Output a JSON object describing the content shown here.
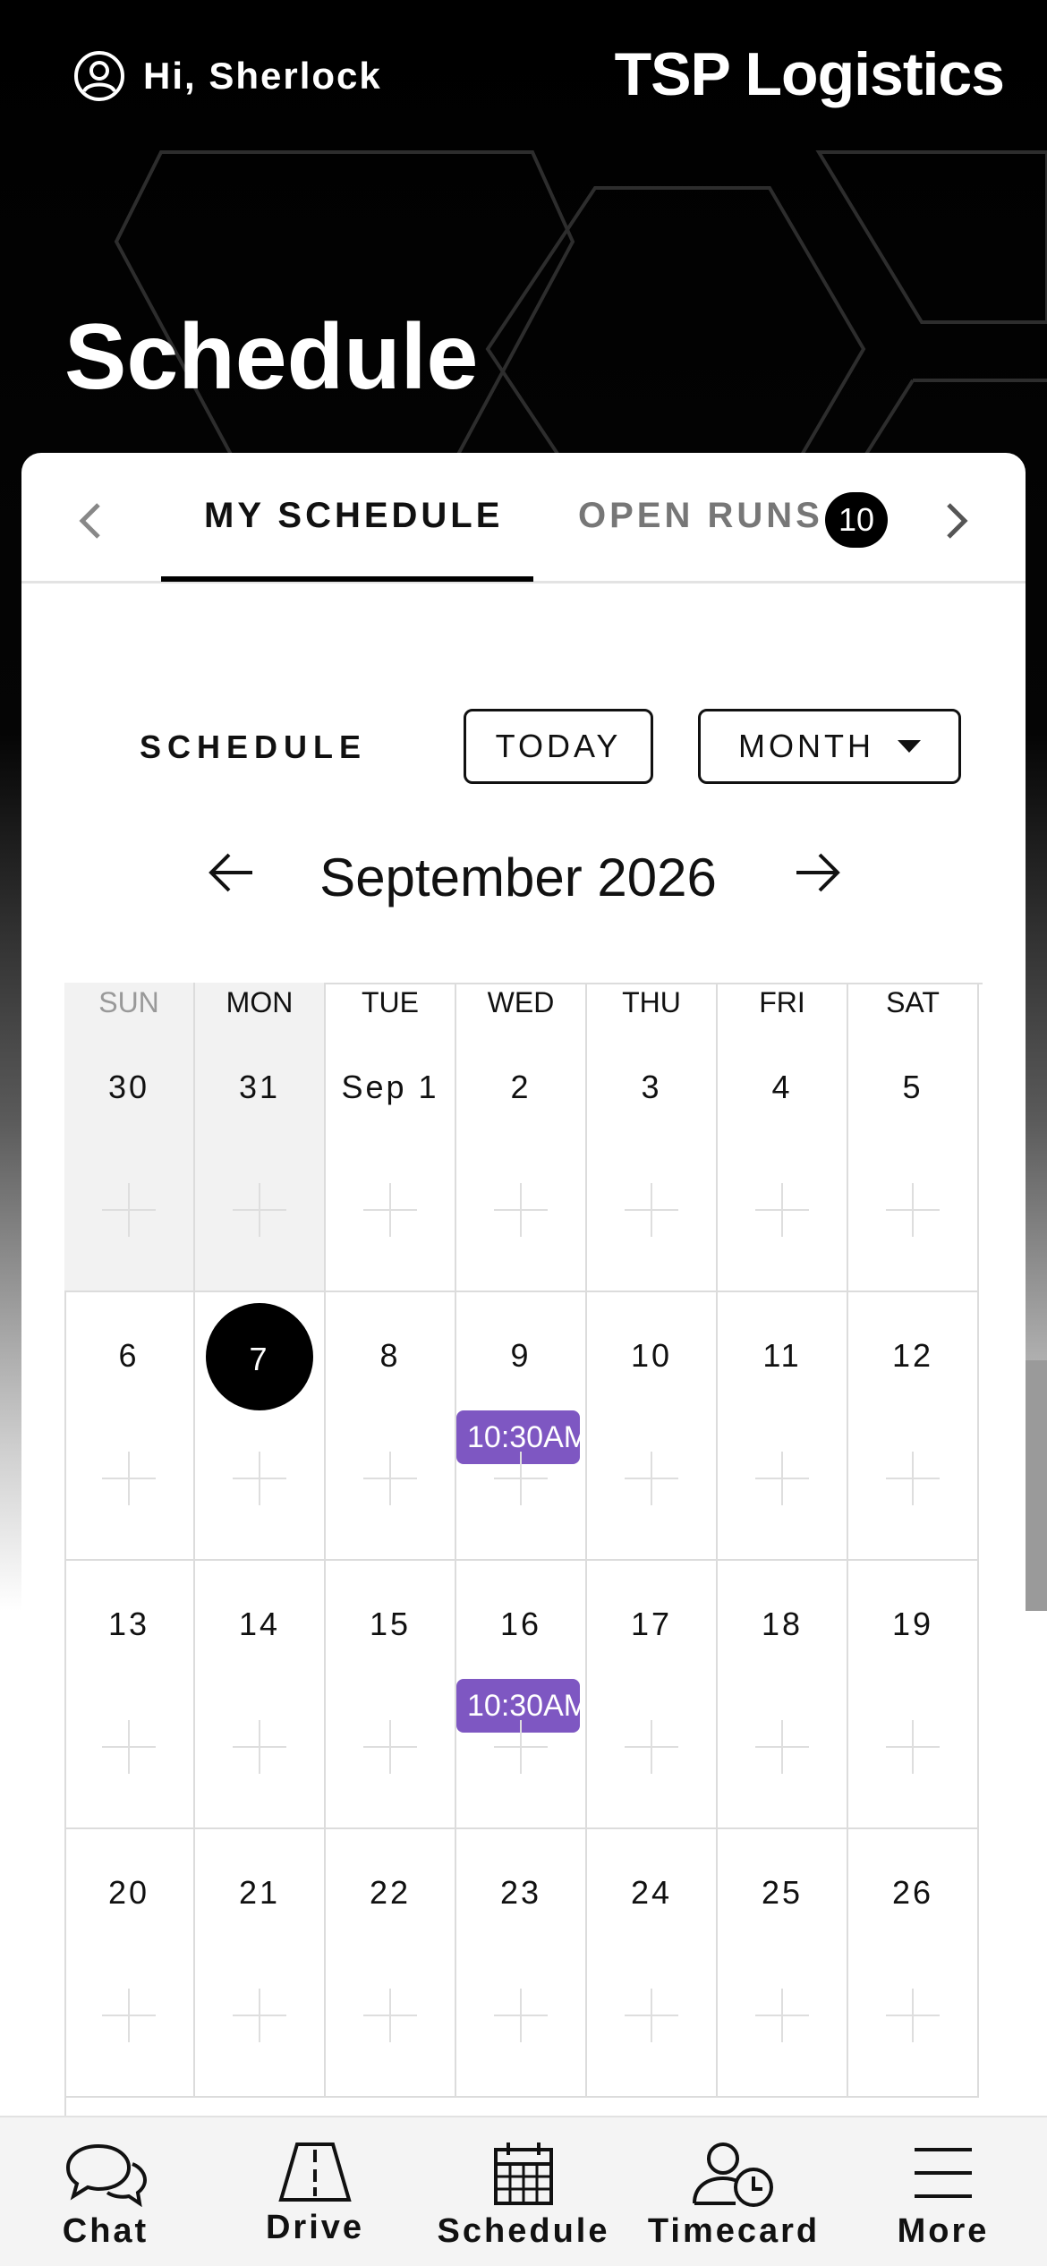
{
  "header": {
    "greeting": "Hi, Sherlock",
    "brand": "TSP Logistics",
    "page_title": "Schedule"
  },
  "tabs": {
    "my_schedule": "MY SCHEDULE",
    "open_runs": "OPEN RUNS",
    "open_runs_count": "10"
  },
  "toolbar": {
    "label": "SCHEDULE",
    "today_button": "TODAY",
    "view_select": "MONTH"
  },
  "calendar": {
    "month_title": "September 2026",
    "weekdays": [
      "SUN",
      "MON",
      "TUE",
      "WED",
      "THU",
      "FRI",
      "SAT"
    ],
    "weeks": [
      [
        "30",
        "31",
        "Sep 1",
        "2",
        "3",
        "4",
        "5"
      ],
      [
        "6",
        "7",
        "8",
        "9",
        "10",
        "11",
        "12"
      ],
      [
        "13",
        "14",
        "15",
        "16",
        "17",
        "18",
        "19"
      ],
      [
        "20",
        "21",
        "22",
        "23",
        "24",
        "25",
        "26"
      ]
    ],
    "selected_day": "7",
    "events": [
      {
        "day": "9",
        "label": "10:30AM"
      },
      {
        "day": "16",
        "label": "10:30AM"
      }
    ]
  },
  "bottom_nav": [
    {
      "label": "Chat",
      "icon": "chat-icon"
    },
    {
      "label": "Drive",
      "icon": "road-icon"
    },
    {
      "label": "Schedule",
      "icon": "calendar-icon"
    },
    {
      "label": "Timecard",
      "icon": "user-clock-icon"
    },
    {
      "label": "More",
      "icon": "menu-icon"
    }
  ],
  "colors": {
    "event": "#7e57c2",
    "accent": "#000000",
    "badge": "#000000"
  }
}
